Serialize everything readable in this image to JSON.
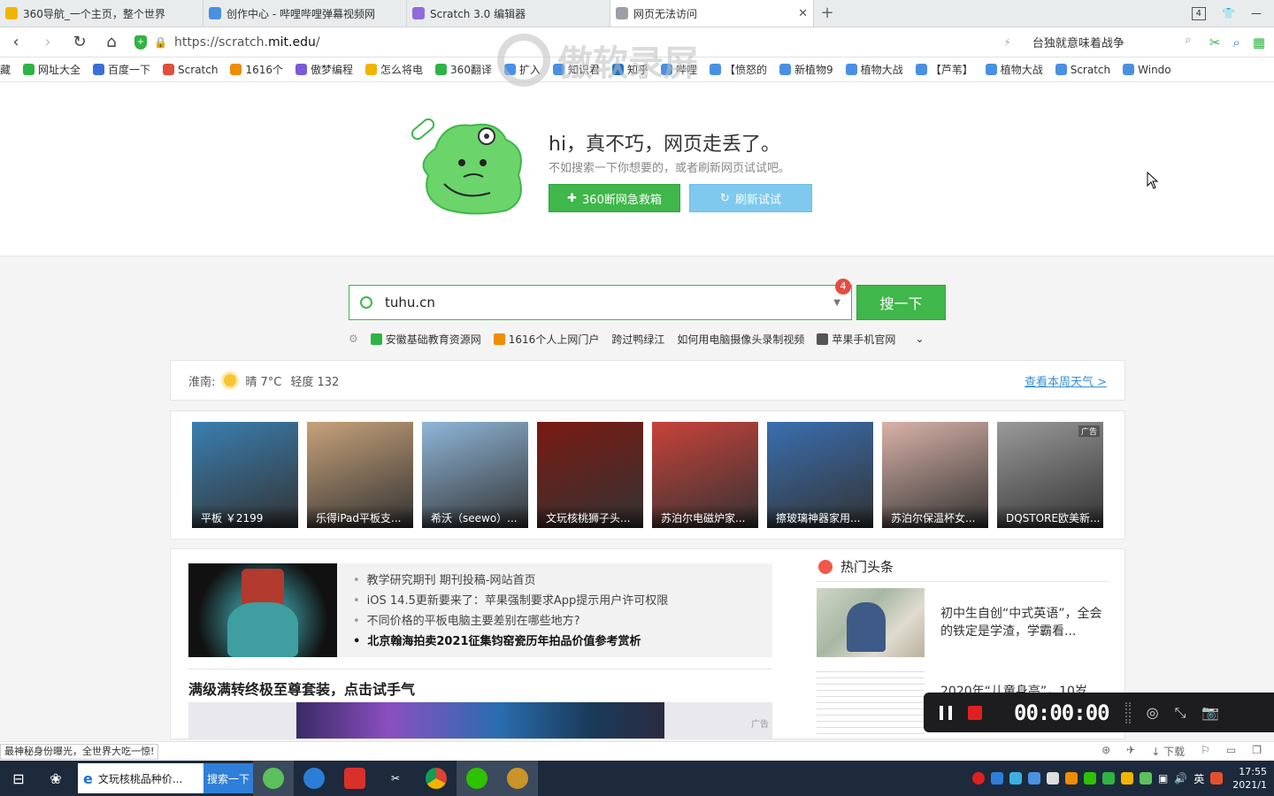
{
  "browser": {
    "tabs": [
      {
        "label": "360导航_一个主页，整个世界",
        "icon_color": "#f1b500",
        "active": false
      },
      {
        "label": "创作中心 - 哔哩哔哩弹幕视频网",
        "icon_color": "#4a90e2",
        "active": false
      },
      {
        "label": "Scratch 3.0 编辑器",
        "icon_color": "#8e6cd9",
        "active": false
      },
      {
        "label": "网页无法访问",
        "icon_color": "#9aa0a6",
        "active": true
      }
    ],
    "tab_count": "4",
    "address": {
      "prefix": "https://scratch.",
      "domain": "mit.edu",
      "suffix": "/"
    },
    "side_search": "台独就意味着战争",
    "bookmarks": [
      {
        "label": "藏",
        "color": "#888"
      },
      {
        "label": "网址大全",
        "color": "#2fb344"
      },
      {
        "label": "百度一下",
        "color": "#3a6fd8"
      },
      {
        "label": "Scratch",
        "color": "#e34e3a"
      },
      {
        "label": "1616个",
        "color": "#f08c00"
      },
      {
        "label": "傲梦编程",
        "color": "#7b5cd6"
      },
      {
        "label": "怎么将电",
        "color": "#f1b500"
      },
      {
        "label": "360翻译",
        "color": "#2fb344"
      },
      {
        "label": "扩入",
        "color": "#4a90e2"
      },
      {
        "label": "知识君",
        "color": "#4a90e2"
      },
      {
        "label": "知乎",
        "color": "#1e73c8"
      },
      {
        "label": "哔哩",
        "color": "#4a90e2"
      },
      {
        "label": "【愤怒的",
        "color": "#4a90e2"
      },
      {
        "label": "新植物9",
        "color": "#4a90e2"
      },
      {
        "label": "植物大战",
        "color": "#4a90e2"
      },
      {
        "label": "【芦苇】",
        "color": "#4a90e2"
      },
      {
        "label": "植物大战",
        "color": "#4a90e2"
      },
      {
        "label": "Scratch",
        "color": "#4a90e2"
      },
      {
        "label": "Windo",
        "color": "#4a90e2"
      }
    ]
  },
  "watermark": "傲软录屏",
  "error": {
    "title": "hi，真不巧，网页走丢了。",
    "subtitle": "不如搜索一下你想要的，或者刷新网页试试吧。",
    "btn_emergency": "360断网急救箱",
    "btn_refresh": "刷新试试"
  },
  "search": {
    "value": "tuhu.cn",
    "badge": "4",
    "button": "搜一下",
    "quicklinks": [
      {
        "label": "安徽基础教育资源网",
        "color": "#2fb344"
      },
      {
        "label": "1616个人上网门户",
        "color": "#f08c00"
      },
      {
        "label": "跨过鸭绿江",
        "color": ""
      },
      {
        "label": "如何用电脑摄像头录制视频",
        "color": ""
      },
      {
        "label": "苹果手机官网",
        "color": "#555"
      }
    ]
  },
  "weather": {
    "city": "淮南:",
    "condition": "晴 7°C",
    "aqi": "轻度 132",
    "link": "查看本周天气 >"
  },
  "ads": [
    {
      "caption": "平板 ￥2199",
      "bg": "#3a7fb0",
      "tag": ""
    },
    {
      "caption": "乐得iPad平板支...",
      "bg": "#c7a27a",
      "tag": ""
    },
    {
      "caption": "希沃（seewo）...",
      "bg": "#8fb6d8",
      "tag": ""
    },
    {
      "caption": "文玩核桃狮子头...",
      "bg": "#7a1a12",
      "tag": ""
    },
    {
      "caption": "苏泊尔电磁炉家...",
      "bg": "#c8423a",
      "tag": ""
    },
    {
      "caption": "擦玻璃神器家用...",
      "bg": "#3a6fb0",
      "tag": ""
    },
    {
      "caption": "苏泊尔保温杯女...",
      "bg": "#d9b2a8",
      "tag": ""
    },
    {
      "caption": "DQSTORE欧美新...",
      "bg": "#9a9a9a",
      "tag": "广告"
    }
  ],
  "news": {
    "items": [
      {
        "text": "教学研究期刊 期刊投稿-网站首页",
        "strong": false
      },
      {
        "text": "iOS 14.5更新要来了：苹果强制要求App提示用户许可权限",
        "strong": false
      },
      {
        "text": "不同价格的平板电脑主要差别在哪些地方?",
        "strong": false
      },
      {
        "text": "北京翰海拍卖2021征集钧窑瓷历年拍品价值参考赏析",
        "strong": true
      }
    ],
    "headline": "满级满转终极至尊套装，点击试手气",
    "banner_tag": "广告",
    "hot_title": "热门头条",
    "hot_items": [
      {
        "text": "初中生自创“中式英语”，全会的铁定是学渣，学霸看..."
      },
      {
        "text": "2020年“儿童身高”，10岁由..."
      }
    ]
  },
  "recorder": {
    "time": "00:00:00"
  },
  "status": {
    "message": "最神秘身份曝光，全世界大吃一惊!",
    "download": "下载"
  },
  "taskbar": {
    "active_app": "文玩核桃品种价...",
    "search_label": "搜索一下",
    "ime": "英",
    "time": "17:55",
    "date": "2021/1"
  }
}
